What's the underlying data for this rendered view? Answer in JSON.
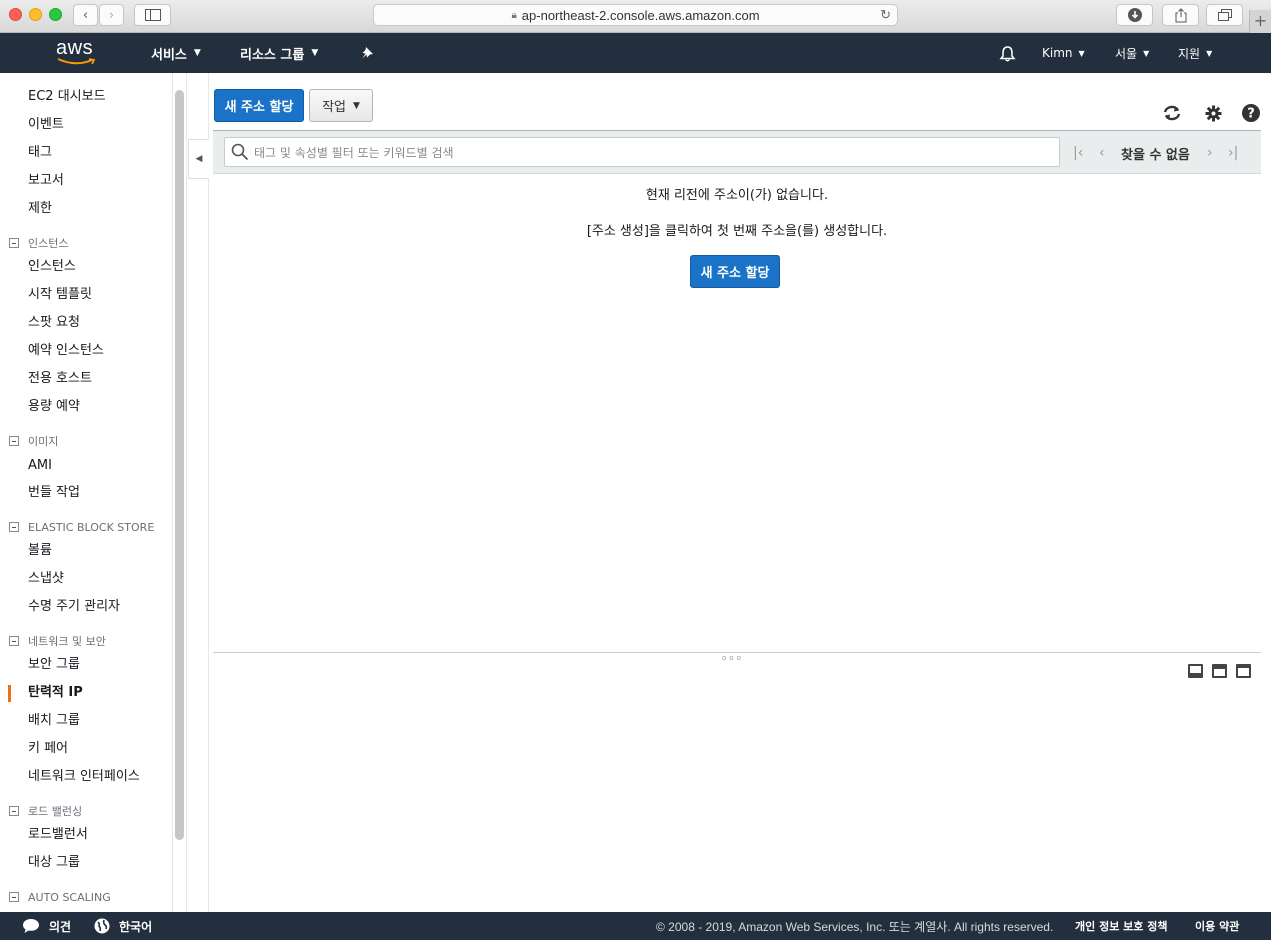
{
  "browser": {
    "url": "ap-northeast-2.console.aws.amazon.com"
  },
  "topnav": {
    "logo_text": "aws",
    "services": "서비스",
    "resource_groups": "리소스 그룹",
    "user": "Kimn",
    "region": "서울",
    "support": "지원"
  },
  "sidebar": {
    "top_links": [
      "EC2 대시보드",
      "이벤트",
      "태그",
      "보고서",
      "제한"
    ],
    "sections": [
      {
        "title": "인스턴스",
        "items": [
          "인스턴스",
          "시작 템플릿",
          "스팟 요청",
          "예약 인스턴스",
          "전용 호스트",
          "용량 예약"
        ]
      },
      {
        "title": "이미지",
        "items": [
          "AMI",
          "번들 작업"
        ]
      },
      {
        "title": "ELASTIC BLOCK STORE",
        "items": [
          "볼륨",
          "스냅샷",
          "수명 주기 관리자"
        ]
      },
      {
        "title": "네트워크 및 보안",
        "items": [
          "보안 그룹",
          "탄력적 IP",
          "배치 그룹",
          "키 페어",
          "네트워크 인터페이스"
        ]
      },
      {
        "title": "로드 밸런싱",
        "items": [
          "로드밸런서",
          "대상 그룹"
        ]
      },
      {
        "title": "AUTO SCALING",
        "items": []
      }
    ],
    "active_item": "탄력적 IP"
  },
  "toolbar": {
    "allocate_button": "새 주소 할당",
    "actions_button": "작업"
  },
  "filter": {
    "placeholder": "태그 및 속성별 필터 또는 키워드별 검색",
    "pager_text": "찾을 수 없음"
  },
  "empty_state": {
    "line1": "현재 리전에 주소이(가) 없습니다.",
    "line2": "[주소 생성]을 클릭하여 첫 번째 주소을(를) 생성합니다.",
    "button": "새 주소 할당"
  },
  "footer": {
    "feedback": "의견",
    "language": "한국어",
    "copyright": "© 2008 - 2019, Amazon Web Services, Inc. 또는 계열사. All rights reserved.",
    "privacy": "개인 정보 보호 정책",
    "terms": "이용 약관"
  },
  "colors": {
    "nav_bg": "#232f3e",
    "primary_btn": "#1a73c7",
    "active_accent": "#ec7211"
  }
}
